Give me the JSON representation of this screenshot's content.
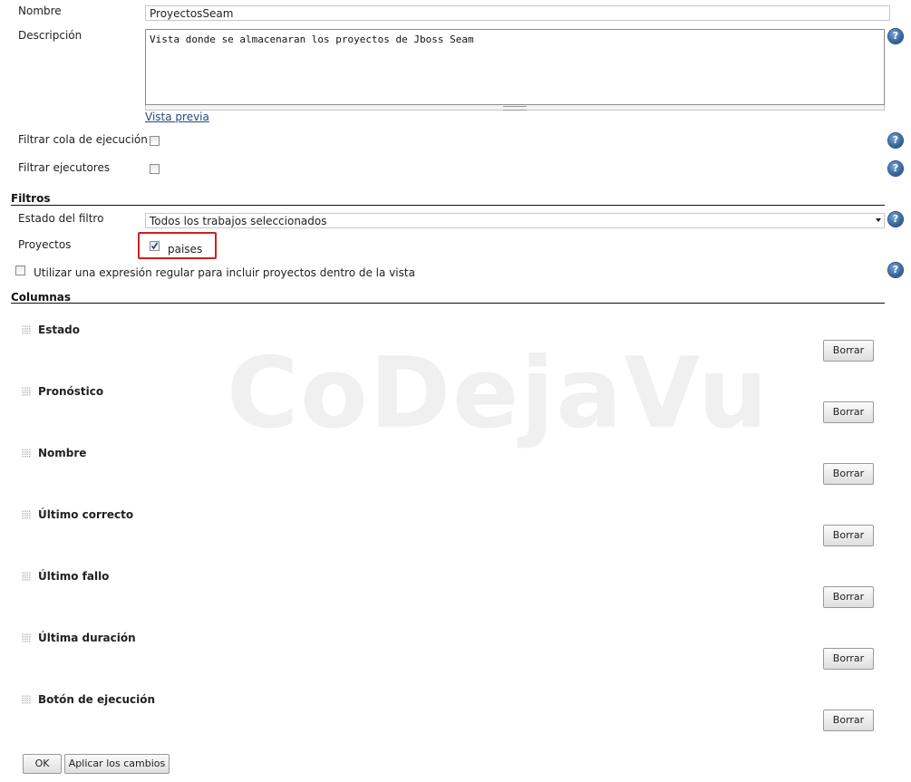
{
  "form": {
    "nombre_label": "Nombre",
    "nombre_value": "ProyectosSeam",
    "descripcion_label": "Descripción",
    "descripcion_value": "Vista donde se almacenaran los proyectos de Jboss Seam",
    "vista_previa_link": "Vista previa",
    "filtrar_cola_label": "Filtrar cola de ejecución",
    "filtrar_ejecutores_label": "Filtrar ejecutores",
    "help_glyph": "?"
  },
  "filtros": {
    "title": "Filtros",
    "estado_label": "Estado del filtro",
    "estado_value": "Todos los trabajos seleccionados",
    "proyectos_label": "Proyectos",
    "proyecto_item": "paises",
    "proyecto_checked": true,
    "regex_label": "Utilizar una expresión regular para incluir proyectos dentro de la vista"
  },
  "columnas": {
    "title": "Columnas",
    "delete_label": "Borrar",
    "items": [
      "Estado",
      "Pronóstico",
      "Nombre",
      "Último correcto",
      "Último fallo",
      "Última duración",
      "Botón de ejecución"
    ]
  },
  "actions": {
    "ok_label": "OK",
    "apply_label": "Aplicar los cambios"
  },
  "watermark": "CoDejaVu"
}
